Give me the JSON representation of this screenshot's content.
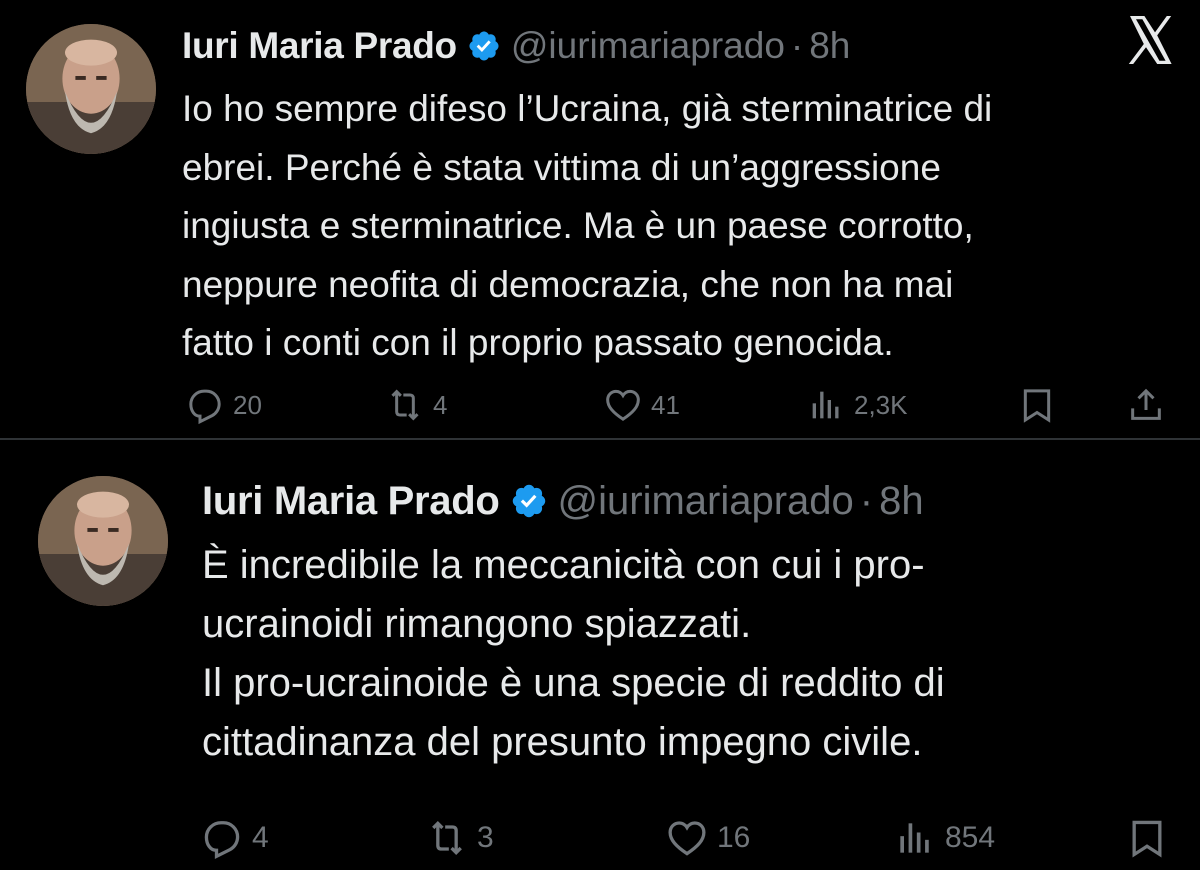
{
  "app": {
    "logo_icon": "x-logo-icon"
  },
  "colors": {
    "background": "#000000",
    "text": "#e7e9ea",
    "muted": "#71767b",
    "verified": "#1d9bf0",
    "divider": "#2f3336"
  },
  "tweets": [
    {
      "name": "Iuri Maria Prado",
      "handle": "@iurimariaprado",
      "separator": "·",
      "time": "8h",
      "verified_icon": "verified-badge-icon",
      "text": "Io ho sempre difeso l’Ucraina, già sterminatrice di\nebrei. Perché è stata vittima di un’aggressione\ningiusta e sterminatrice. Ma è un paese corrotto,\nneppure neofita di democrazia, che non ha mai\nfatto i conti con il proprio passato genocida.",
      "actions": {
        "replies": "20",
        "reposts": "4",
        "likes": "41",
        "views": "2,3K"
      }
    },
    {
      "name": "Iuri Maria Prado",
      "handle": "@iurimariaprado",
      "separator": "·",
      "time": "8h",
      "verified_icon": "verified-badge-icon",
      "text": "È incredibile la meccanicità con cui i pro-\nucrainoidi rimangono spiazzati.\nIl pro-ucrainoide è una specie di reddito di\ncittadinanza del presunto impegno civile.",
      "actions": {
        "replies": "4",
        "reposts": "3",
        "likes": "16",
        "views": "854"
      }
    }
  ]
}
